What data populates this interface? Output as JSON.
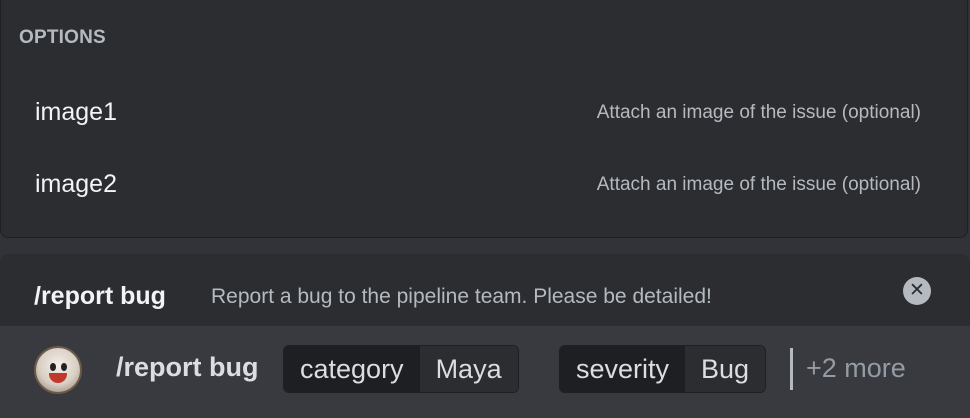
{
  "options": {
    "header": "OPTIONS",
    "items": [
      {
        "name": "image1",
        "description": "Attach an image of the issue (optional)"
      },
      {
        "name": "image2",
        "description": "Attach an image of the issue (optional)"
      }
    ]
  },
  "command": {
    "title": "/report bug",
    "description": "Report a bug to the pipeline team. Please be detailed!",
    "close_icon": "close-icon",
    "close_glyph": "✕"
  },
  "input": {
    "command": "/report bug",
    "params": [
      {
        "key": "category",
        "value": "Maya"
      },
      {
        "key": "severity",
        "value": "Bug"
      }
    ],
    "more_label": "+2 more"
  },
  "colors": {
    "background": "#313338",
    "panel": "#2b2d31",
    "input_bar": "#383a40",
    "text_primary": "#f2f3f5",
    "text_muted": "#b5bac1"
  }
}
